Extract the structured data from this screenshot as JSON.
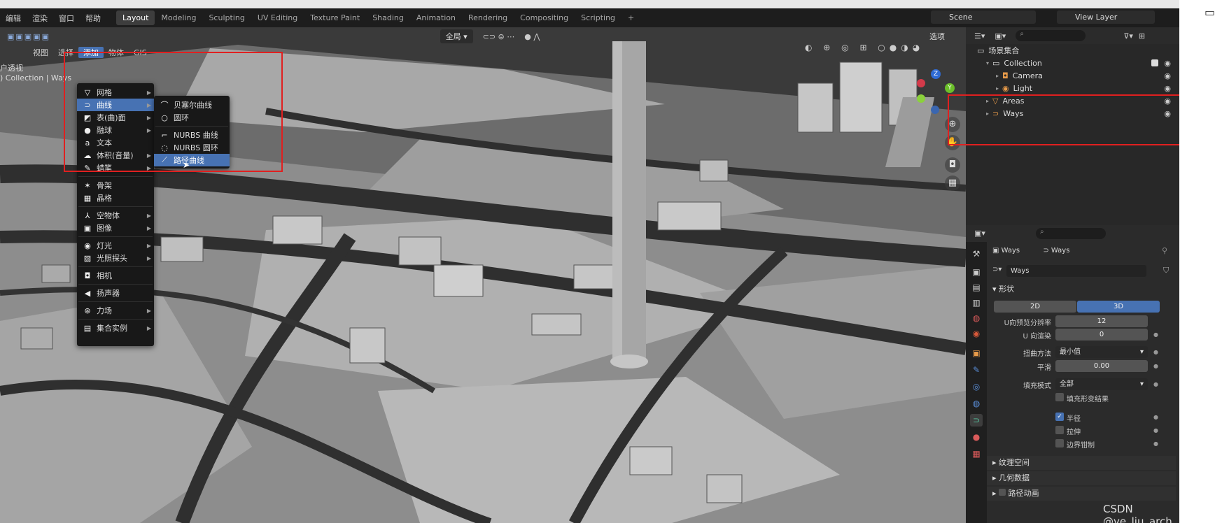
{
  "topmenu": [
    "编辑",
    "渲染",
    "窗口",
    "帮助"
  ],
  "workspaces": {
    "tabs": [
      "Layout",
      "Modeling",
      "Sculpting",
      "UV Editing",
      "Texture Paint",
      "Shading",
      "Animation",
      "Rendering",
      "Compositing",
      "Scripting"
    ],
    "active": "Layout",
    "add_icon": "+"
  },
  "scene_name": "Scene",
  "view_layer": "View Layer",
  "viewport": {
    "menus": [
      "视图",
      "选择",
      "添加",
      "物体",
      "GIS"
    ],
    "active_menu": "添加",
    "transform_orientation": "全局",
    "select_label": "选项",
    "info_line1": "户透视",
    "info_line2": ") Collection | Ways"
  },
  "add_menu": {
    "items": [
      {
        "label": "网格",
        "icon": "mesh-icon",
        "glyph": "▽",
        "arrow": true
      },
      {
        "label": "曲线",
        "icon": "curve-icon",
        "glyph": "⊃",
        "arrow": true,
        "active": true
      },
      {
        "label": "表(曲)面",
        "icon": "surface-icon",
        "glyph": "◩",
        "arrow": true
      },
      {
        "label": "融球",
        "icon": "metaball-icon",
        "glyph": "●",
        "arrow": true
      },
      {
        "label": "文本",
        "icon": "text-icon",
        "glyph": "a",
        "arrow": false
      },
      {
        "label": "体积(音量)",
        "icon": "volume-icon",
        "glyph": "☁",
        "arrow": true
      },
      {
        "label": "蜡笔",
        "icon": "grease-pencil-icon",
        "glyph": "✎",
        "arrow": true
      },
      {
        "label": "骨架",
        "icon": "armature-icon",
        "glyph": "✶",
        "arrow": false,
        "sep_before": true
      },
      {
        "label": "晶格",
        "icon": "lattice-icon",
        "glyph": "▦",
        "arrow": false
      },
      {
        "label": "空物体",
        "icon": "empty-icon",
        "glyph": "⅄",
        "arrow": true,
        "sep_before": true
      },
      {
        "label": "图像",
        "icon": "image-icon",
        "glyph": "▣",
        "arrow": true
      },
      {
        "label": "灯光",
        "icon": "light-icon",
        "glyph": "◉",
        "arrow": true,
        "sep_before": true
      },
      {
        "label": "光照探头",
        "icon": "light-probe-icon",
        "glyph": "▨",
        "arrow": true
      },
      {
        "label": "相机",
        "icon": "camera-icon",
        "glyph": "◘",
        "arrow": false,
        "sep_before": true
      },
      {
        "label": "扬声器",
        "icon": "speaker-icon",
        "glyph": "◀",
        "arrow": false,
        "sep_before": true
      },
      {
        "label": "力场",
        "icon": "force-field-icon",
        "glyph": "⊛",
        "arrow": true,
        "sep_before": true
      },
      {
        "label": "集合实例",
        "icon": "collection-instance-icon",
        "glyph": "▤",
        "arrow": true,
        "sep_before": true
      }
    ]
  },
  "curve_submenu": {
    "items": [
      {
        "label": "贝塞尔曲线",
        "icon": "bezier-curve-icon",
        "glyph": "⌒"
      },
      {
        "label": "圆环",
        "icon": "bezier-circle-icon",
        "glyph": "○"
      },
      {
        "label": "NURBS 曲线",
        "icon": "nurbs-curve-icon",
        "glyph": "⌐",
        "sep_before": true
      },
      {
        "label": "NURBS 圆环",
        "icon": "nurbs-circle-icon",
        "glyph": "◌"
      },
      {
        "label": "路径曲线",
        "icon": "path-curve-icon",
        "glyph": "⟋",
        "active": true
      }
    ]
  },
  "outliner": {
    "title": "场景集合",
    "rows": [
      {
        "label": "Collection",
        "icon": "collection-icon",
        "glyph": "▭",
        "indent": 1,
        "tri": "▾",
        "check": true
      },
      {
        "label": "Camera",
        "icon": "camera-object-icon",
        "glyph": "◘",
        "indent": 2,
        "tri": "▸",
        "color": "#e89b4a"
      },
      {
        "label": "Light",
        "icon": "light-object-icon",
        "glyph": "◉",
        "indent": 2,
        "tri": "▸",
        "color": "#e89b4a"
      },
      {
        "label": "Areas",
        "icon": "mesh-object-icon",
        "glyph": "▽",
        "indent": 1,
        "tri": "▸",
        "color": "#e89b4a"
      },
      {
        "label": "Ways",
        "icon": "curve-object-icon",
        "glyph": "⊃",
        "indent": 1,
        "tri": "▸",
        "color": "#e89b4a"
      }
    ]
  },
  "properties": {
    "breadcrumb_object": "Ways",
    "breadcrumb_data": "Ways",
    "datablock_name": "Ways",
    "shape_section": "形状",
    "mode_2d": "2D",
    "mode_3d": "3D",
    "fields": [
      {
        "label": "U向预览分辨率",
        "value": "12"
      },
      {
        "label": "U 向渲染",
        "value": "0"
      }
    ],
    "twist_label": "扭曲方法",
    "twist_value": "最小值",
    "smooth_label": "平滑",
    "smooth_value": "0.00",
    "fill_label": "填充模式",
    "fill_value": "全部",
    "fill_deformed": "填充形变结果",
    "radius": "半径",
    "stretch": "拉伸",
    "bounds_clamp": "边界钳制",
    "sections": [
      "纹理空间",
      "几何数据",
      "路径动画"
    ]
  },
  "watermark": "CSDN @ye_liu_arch"
}
